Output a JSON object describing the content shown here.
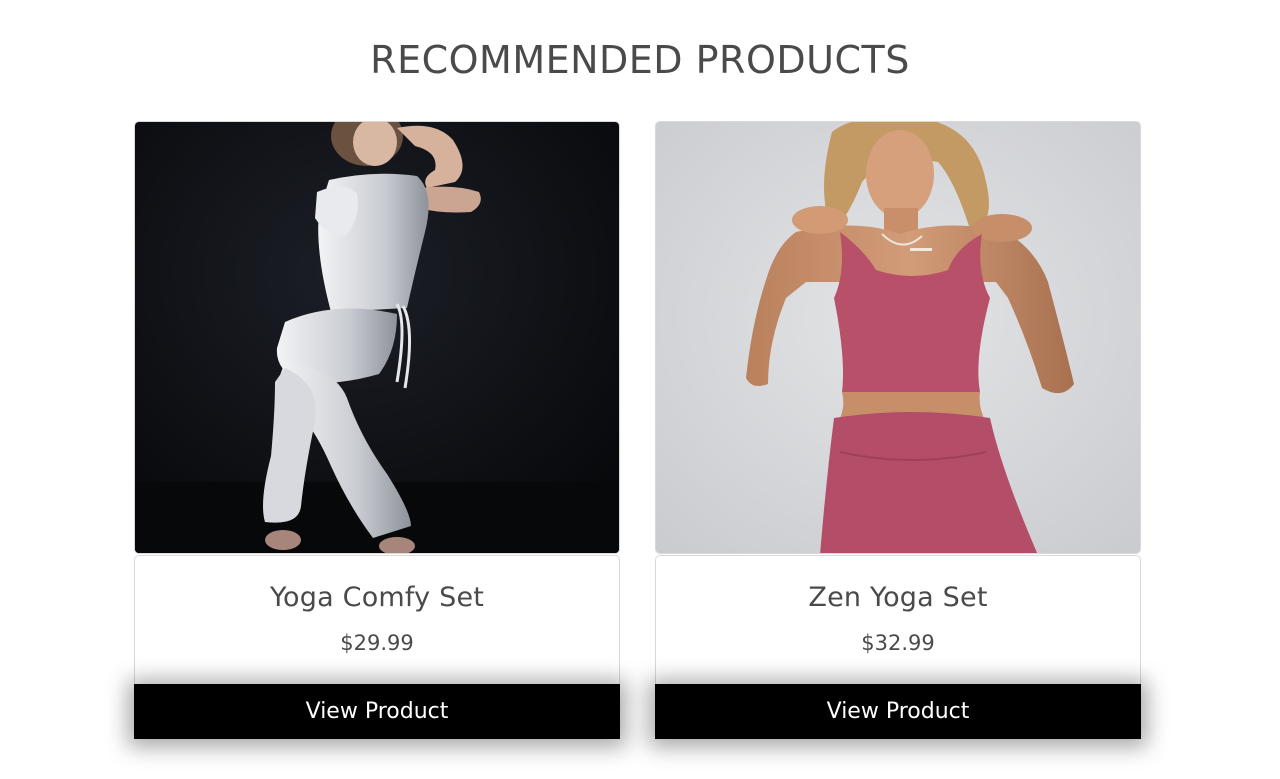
{
  "section": {
    "title": "RECOMMENDED PRODUCTS"
  },
  "products": [
    {
      "name": "Yoga Comfy Set",
      "price": "$29.99",
      "button_label": "View Product",
      "image": "dancer-in-white-jumpsuit-photo"
    },
    {
      "name": "Zen Yoga Set",
      "price": "$32.99",
      "button_label": "View Product",
      "image": "model-in-pink-yoga-set-photo"
    }
  ],
  "colors": {
    "title_text": "#4a4a4a",
    "button_bg": "#000000",
    "button_text": "#ffffff",
    "card_border": "#d9d9d9",
    "product_1_bg": "#0b0c10",
    "product_2_bg": "#d8d9dc",
    "product_2_garment": "#b8506a"
  }
}
